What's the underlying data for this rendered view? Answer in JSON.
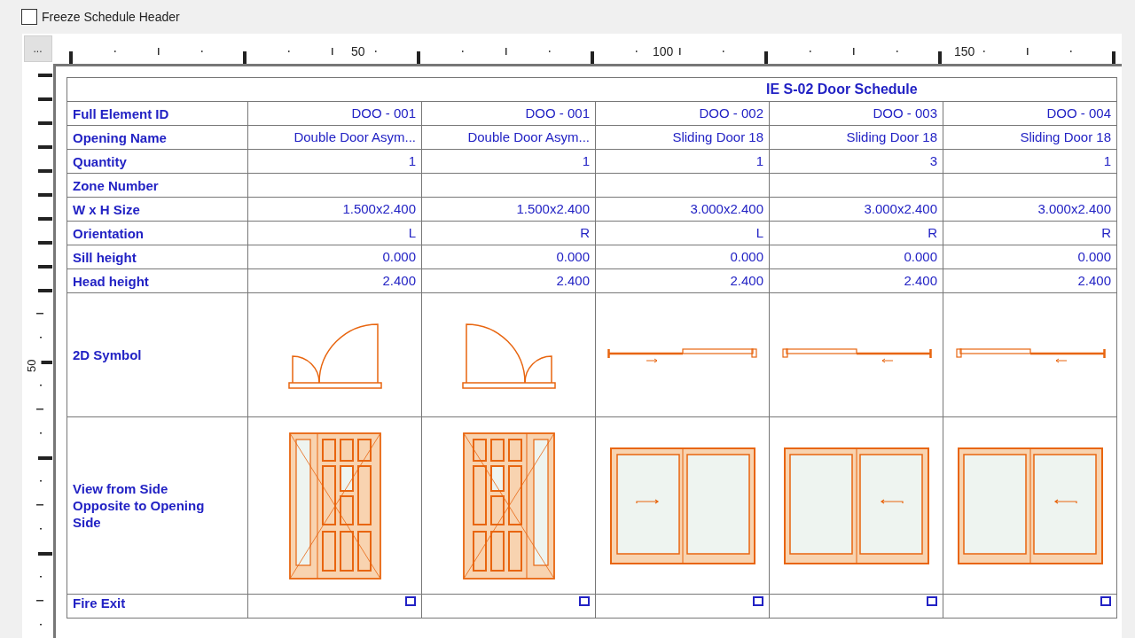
{
  "freeze_header": {
    "label": "Freeze Schedule Header",
    "checked": false
  },
  "ruler_button": "...",
  "top_ruler_labels": [
    "50",
    "100",
    "150"
  ],
  "left_ruler_labels": [
    "50"
  ],
  "schedule": {
    "title": "IE S-02 Door Schedule",
    "rows": [
      {
        "label": "Full Element ID",
        "kind": "text",
        "values": [
          "DOO - 001",
          "DOO - 001",
          "DOO - 002",
          "DOO - 003",
          "DOO - 004"
        ]
      },
      {
        "label": "Opening Name",
        "kind": "text",
        "values": [
          "Double Door Asym...",
          "Double Door Asym...",
          "Sliding Door 18",
          "Sliding Door 18",
          "Sliding Door 18"
        ]
      },
      {
        "label": "Quantity",
        "kind": "text",
        "values": [
          "1",
          "1",
          "1",
          "3",
          "1"
        ]
      },
      {
        "label": "Zone Number",
        "kind": "text",
        "values": []
      },
      {
        "label": "W x H Size",
        "kind": "text",
        "values": [
          "1.500x2.400",
          "1.500x2.400",
          "3.000x2.400",
          "3.000x2.400",
          "3.000x2.400"
        ]
      },
      {
        "label": "Orientation",
        "kind": "text",
        "values": [
          "L",
          "R",
          "L",
          "R",
          "R"
        ]
      },
      {
        "label": "Sill height",
        "kind": "text",
        "values": [
          "0.000",
          "0.000",
          "0.000",
          "0.000",
          "0.000"
        ]
      },
      {
        "label": "Head height",
        "kind": "text",
        "values": [
          "2.400",
          "2.400",
          "2.400",
          "2.400",
          "2.400"
        ]
      },
      {
        "label": "2D Symbol",
        "kind": "symbol",
        "items": [
          {
            "kind": "swing",
            "mirrored": false
          },
          {
            "kind": "swing",
            "mirrored": true
          },
          {
            "kind": "slide",
            "mirrored": false
          },
          {
            "kind": "slide",
            "mirrored": true
          },
          {
            "kind": "slide",
            "mirrored": true
          }
        ]
      },
      {
        "label": "View from Side Opposite to Opening Side",
        "kind": "elevation",
        "items": [
          {
            "kind": "panel",
            "mirrored": false
          },
          {
            "kind": "panel",
            "mirrored": true
          },
          {
            "kind": "slide",
            "mirrored": false
          },
          {
            "kind": "slide",
            "mirrored": true
          },
          {
            "kind": "slide",
            "mirrored": true
          }
        ]
      },
      {
        "label": "Fire Exit",
        "kind": "checkbox",
        "items": [
          {
            "checked": false
          },
          {
            "checked": false
          },
          {
            "checked": false
          },
          {
            "checked": false
          },
          {
            "checked": false
          }
        ]
      }
    ]
  }
}
